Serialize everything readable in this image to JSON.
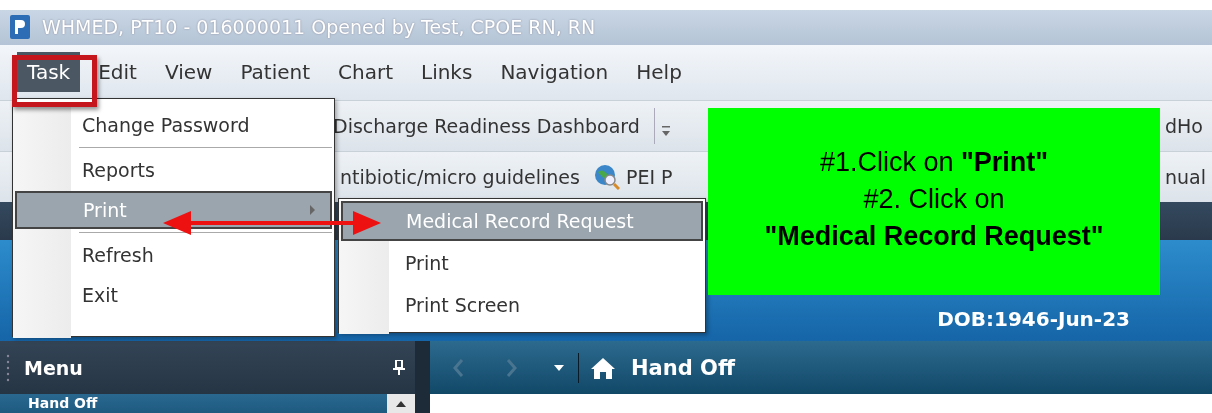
{
  "window": {
    "title": "WHMED, PT10 - 016000011 Opened by Test, CPOE RN, RN"
  },
  "menu_bar": [
    {
      "label": "Task",
      "selected": true
    },
    {
      "label": "Edit",
      "selected": false
    },
    {
      "label": "View",
      "selected": false
    },
    {
      "label": "Patient",
      "selected": false
    },
    {
      "label": "Chart",
      "selected": false
    },
    {
      "label": "Links",
      "selected": false
    },
    {
      "label": "Navigation",
      "selected": false
    },
    {
      "label": "Help",
      "selected": false
    }
  ],
  "toolbar_1": {
    "left": "Discharge Readiness Dashboard",
    "right": "dHo"
  },
  "toolbar_2": {
    "left": "ntibiotic/micro guidelines",
    "middle": "PEI P",
    "right": "nual"
  },
  "task_menu": {
    "groups": [
      {
        "items": [
          {
            "label": "Change Password",
            "selected": false,
            "has_submenu": false
          }
        ]
      },
      {
        "items": [
          {
            "label": "Reports",
            "selected": false,
            "has_submenu": false
          },
          {
            "label": "Print",
            "selected": true,
            "has_submenu": true
          }
        ]
      },
      {
        "items": [
          {
            "label": "Refresh",
            "selected": false,
            "has_submenu": false
          },
          {
            "label": "Exit",
            "selected": false,
            "has_submenu": false
          }
        ]
      }
    ]
  },
  "print_submenu": [
    {
      "label": "Medical Record Request",
      "selected": true
    },
    {
      "label": "Print",
      "selected": false
    },
    {
      "label": "Print Screen",
      "selected": false
    }
  ],
  "banner": {
    "dob": "DOB:1946-Jun-23"
  },
  "menu_panel": {
    "title": "Menu",
    "items": [
      "Hand Off"
    ]
  },
  "nav_bar": {
    "title": "Hand Off"
  },
  "callout": {
    "text": "#1.Click on **\"Print\"**\n#2. Click on\n**\"Medical Record Request\"**"
  }
}
